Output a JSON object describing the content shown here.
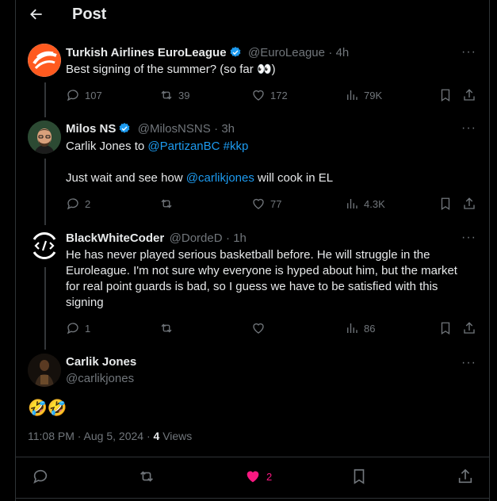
{
  "header": {
    "title": "Post"
  },
  "tweets": [
    {
      "name": "Turkish Airlines EuroLeague",
      "handle": "@EuroLeague",
      "time": "· 4h",
      "text": "Best signing of the summer? (so far 👀)",
      "replies": "107",
      "reposts": "39",
      "likes": "172",
      "views": "79K"
    },
    {
      "name": "Milos NS",
      "handle": "@MilosNSNS",
      "time": "· 3h",
      "line1_prefix": "Carlik Jones to ",
      "line1_mention": "@PartizanBC",
      "line1_hashtag": "#kkp",
      "line2_prefix": "Just wait and see how ",
      "line2_mention": "@carlikjones",
      "line2_suffix": " will cook in EL",
      "replies": "2",
      "reposts": "",
      "likes": "77",
      "views": "4.3K"
    },
    {
      "name": "BlackWhiteCoder",
      "handle": "@DordeD",
      "time": "· 1h",
      "text": "He has never played serious basketball before. He will struggle in the Euroleague. I'm not sure why everyone is hyped about him, but the market for real point guards is bad, so I guess we have to be satisfied with this signing",
      "replies": "1",
      "reposts": "",
      "likes": "",
      "views": "86"
    }
  ],
  "main": {
    "name": "Carlik Jones",
    "handle": "@carlikjones",
    "text": "🤣🤣",
    "timestamp": "11:08 PM · Aug 5, 2024 · ",
    "views_count": "4",
    "views_label": " Views",
    "likes": "2"
  },
  "colors": {
    "accent": "#1d9bf0",
    "like": "#f91880",
    "muted": "#71767b",
    "border": "#2f3336"
  }
}
